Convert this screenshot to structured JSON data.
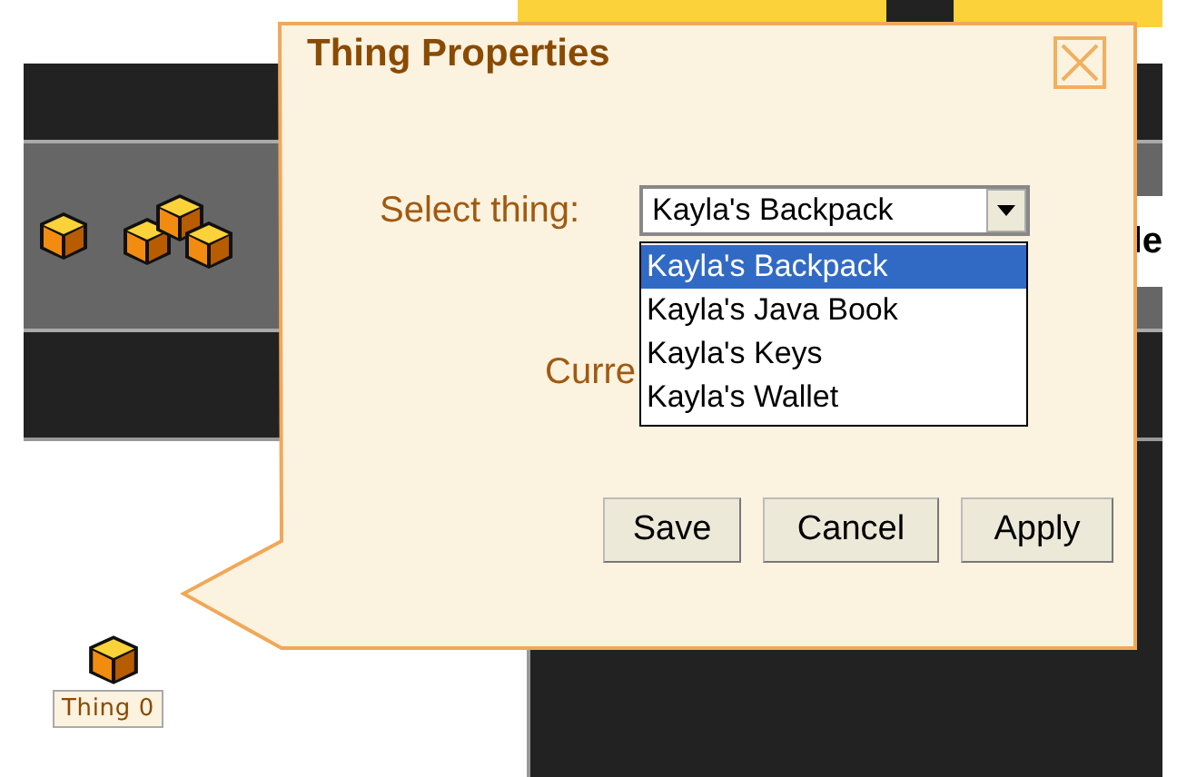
{
  "canvas": {
    "things": [
      {
        "label": "Thing 0"
      }
    ],
    "partial_label": "le"
  },
  "dialog": {
    "title": "Thing Properties",
    "select_label": "Select thing:",
    "select_value": "Kayla's Backpack",
    "options": [
      {
        "label": "Kayla's Backpack",
        "selected": true
      },
      {
        "label": "Kayla's Java Book",
        "selected": false
      },
      {
        "label": "Kayla's Keys",
        "selected": false
      },
      {
        "label": "Kayla's Wallet",
        "selected": false
      }
    ],
    "current_label": "Curre",
    "buttons": [
      "Save",
      "Cancel",
      "Apply"
    ]
  }
}
